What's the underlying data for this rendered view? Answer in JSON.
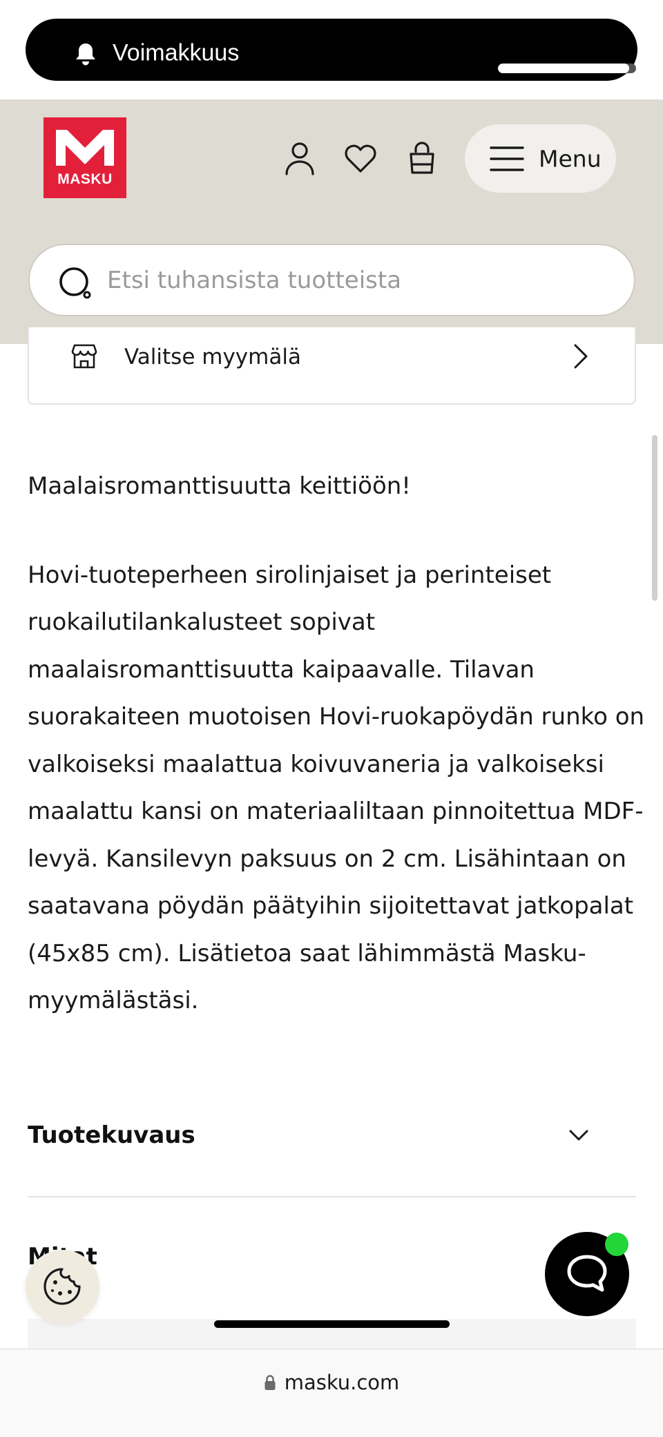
{
  "volume_hud": {
    "label": "Voimakkuus",
    "level_percent": 95
  },
  "header": {
    "logo_text": "MASKU",
    "menu_label": "Menu",
    "search_placeholder": "Etsi tuhansista tuotteista",
    "colors": {
      "header_bg": "#dedbd2",
      "brand_red": "#e3203a"
    }
  },
  "store_selector": {
    "label": "Valitse myymälä"
  },
  "description": {
    "lead": "Maalaisromanttisuutta keittiöön!",
    "lines": [
      "Hovi-tuoteperheen sirolinjaiset ja perinteiset",
      "ruokailutilankalusteet sopivat",
      "maalaisromanttisuutta kaipaavalle. Tilavan",
      "suorakaiteen muotoisen Hovi-ruokapöydän runko on",
      "valkoiseksi maalattua koivuvaneria ja valkoiseksi",
      "maalattu kansi on materiaaliltaan pinnoitettua MDF-",
      "levyä. Kansilevyn paksuus on 2 cm. Lisähintaan on",
      "saatavana pöydän päätyihin sijoitettavat jatkopalat",
      "(45x85 cm). Lisätietoa saat lähimmästä Masku-",
      "myymälästäsi."
    ]
  },
  "accordion": [
    {
      "title": "Tuotekuvaus"
    },
    {
      "title": "Mitat"
    }
  ],
  "browser": {
    "url": "masku.com"
  },
  "chat": {
    "online_color": "#22d63a"
  }
}
